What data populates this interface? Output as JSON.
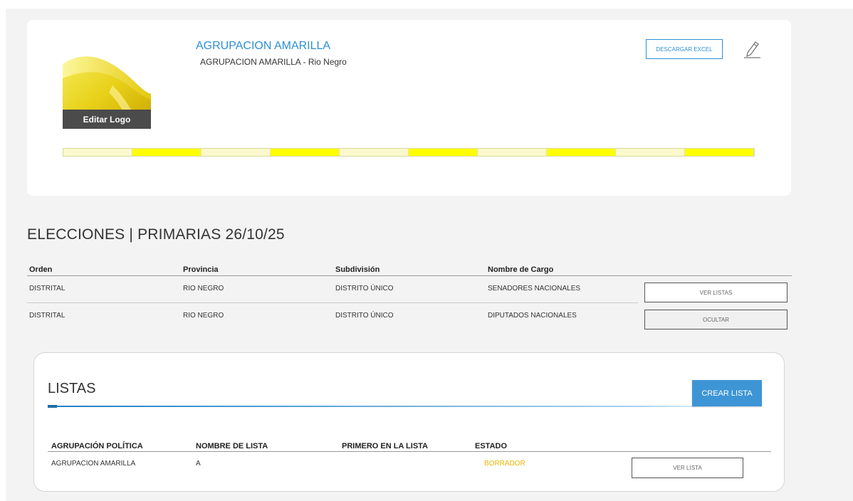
{
  "header": {
    "party_name": "AGRUPACION AMARILLA",
    "party_subtitle": "AGRUPACION AMARILLA - Rio Negro",
    "edit_logo_label": "Editar Logo",
    "download_excel_label": "DESCARGAR EXCEL",
    "edit_icon": "pencil-icon",
    "colors": {
      "title": "#2d8fd5",
      "stripe_pale": "#fbf9cc",
      "stripe_bright": "#ffff00"
    }
  },
  "elections": {
    "title": "ELECCIONES | PRIMARIAS 26/10/25",
    "columns": [
      "Orden",
      "Provincia",
      "Subdivisión",
      "Nombre de Cargo"
    ],
    "rows": [
      {
        "orden": "DISTRITAL",
        "provincia": "RIO NEGRO",
        "subdivision": "DISTRITO ÚNICO",
        "cargo": "SENADORES NACIONALES",
        "action": "VER LISTAS"
      },
      {
        "orden": "DISTRITAL",
        "provincia": "RIO NEGRO",
        "subdivision": "DISTRITO ÚNICO",
        "cargo": "DIPUTADOS NACIONALES",
        "action": "OCULTAR"
      }
    ]
  },
  "listas": {
    "title": "LISTAS",
    "create_label": "CREAR LISTA",
    "columns": [
      "AGRUPACIÓN POLÍTICA",
      "NOMBRE DE LISTA",
      "PRIMERO EN LA LISTA",
      "ESTADO"
    ],
    "rows": [
      {
        "agrupacion": "AGRUPACION AMARILLA",
        "nombre": "A",
        "primero": "",
        "estado": "BORRADOR",
        "action": "VER LISTA"
      }
    ],
    "colors": {
      "estado_borrador": "#e6b800",
      "create_button": "#3d95d6"
    }
  }
}
